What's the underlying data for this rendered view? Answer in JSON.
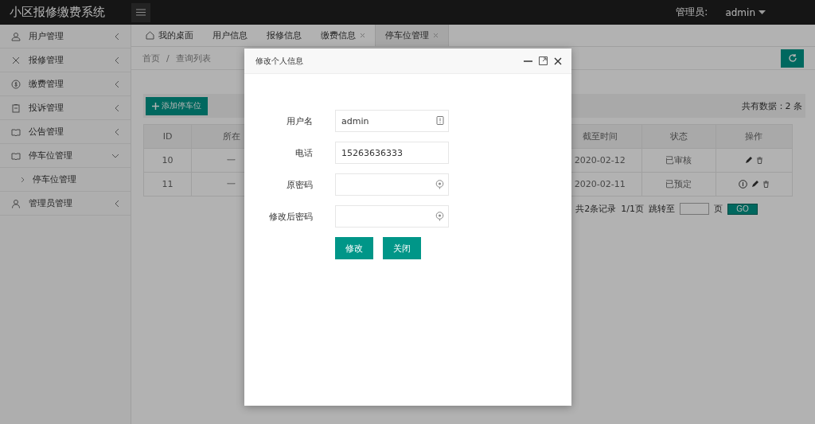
{
  "header": {
    "title": "小区报修缴费系统",
    "user_label": "管理员:",
    "user_name": "admin"
  },
  "sidebar": {
    "items": [
      {
        "label": "用户管理",
        "expanded": false
      },
      {
        "label": "报修管理",
        "expanded": false
      },
      {
        "label": "缴费管理",
        "expanded": false
      },
      {
        "label": "投诉管理",
        "expanded": false
      },
      {
        "label": "公告管理",
        "expanded": false
      },
      {
        "label": "停车位管理",
        "expanded": true,
        "children": [
          {
            "label": "停车位管理"
          }
        ]
      },
      {
        "label": "管理员管理",
        "expanded": false
      }
    ]
  },
  "tabs": [
    {
      "label": "我的桌面",
      "kind": "home",
      "selected": false
    },
    {
      "label": "用户信息",
      "kind": "plain",
      "selected": false
    },
    {
      "label": "报修信息",
      "kind": "plain",
      "selected": false
    },
    {
      "label": "缴费信息",
      "kind": "closable",
      "selected": false
    },
    {
      "label": "停车位管理",
      "kind": "closable",
      "selected": true
    }
  ],
  "breadcrumb": [
    "首页",
    "/",
    "查询列表"
  ],
  "add_button": "添加停车位",
  "total": "共有数据：2 条",
  "table": {
    "columns": [
      "ID",
      "所在",
      "截至时间",
      "状态",
      "操作"
    ],
    "rows": [
      {
        "cells": [
          "10",
          "一",
          "2020-02-12",
          "已审核"
        ],
        "actions": [
          {
            "kind": "edit"
          },
          {
            "kind": "delete"
          }
        ]
      },
      {
        "cells": [
          "11",
          "一",
          "2020-02-11",
          "已预定"
        ],
        "actions": [
          {
            "kind": "info"
          },
          {
            "kind": "edit"
          },
          {
            "kind": "delete"
          }
        ]
      }
    ]
  },
  "pagination": {
    "records": "共2条记录",
    "pages": "1/1页",
    "jump_label": "跳转至",
    "page_unit": "页",
    "go": "GO"
  },
  "dialog": {
    "title": "修改个人信息",
    "fields": [
      {
        "label": "用户名",
        "value": "admin"
      },
      {
        "label": "电话",
        "value": "15263636333"
      },
      {
        "label": "原密码"
      },
      {
        "label": "修改后密码"
      }
    ],
    "buttons": [
      "修改",
      "关闭"
    ]
  }
}
